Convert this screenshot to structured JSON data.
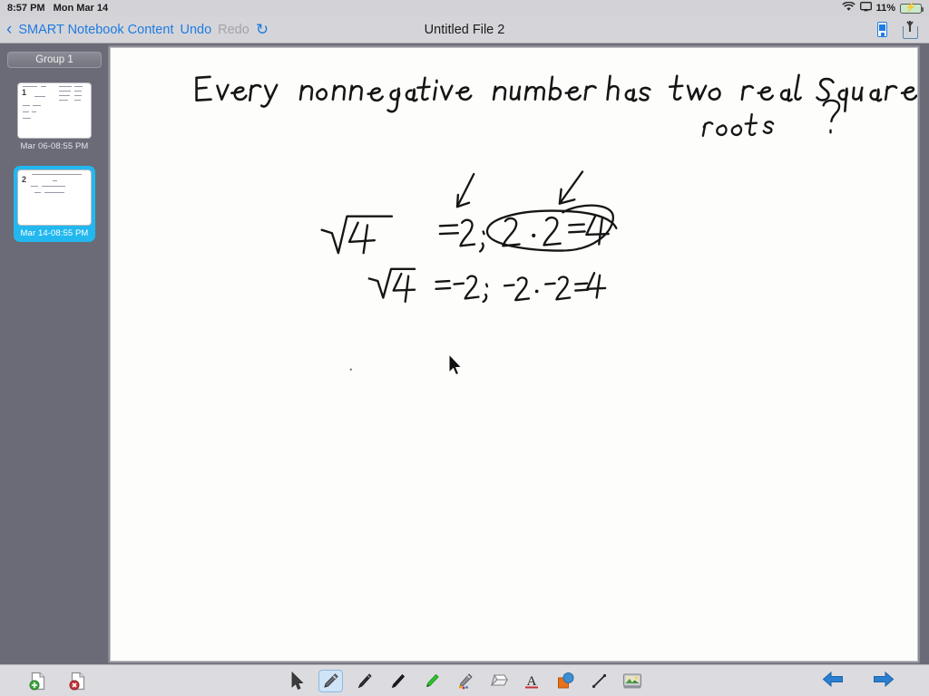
{
  "status_bar": {
    "time": "8:57 PM",
    "date": "Mon Mar 14",
    "battery_percent": "11%",
    "wifi_icon": "wifi-icon",
    "airplay_icon": "airplay-display-icon",
    "battery_icon": "battery-charging-icon"
  },
  "nav_bar": {
    "back_chevron": "‹",
    "back_label": "SMART Notebook Content",
    "undo_label": "Undo",
    "redo_label": "Redo",
    "refresh_icon": "↻",
    "title": "Untitled File 2",
    "device_icon": "device-icon",
    "share_icon": "share-icon"
  },
  "sidebar": {
    "group_label": "Group 1",
    "pages": [
      {
        "number": "1",
        "timestamp": "Mar 06-08:55 PM",
        "selected": false
      },
      {
        "number": "2",
        "timestamp": "Mar 14-08:55 PM",
        "selected": true
      }
    ],
    "selected_color": "#22b8ef"
  },
  "canvas": {
    "heading": "Every nonnegative number has two real square roots ?",
    "equation_1": "√4 = 2 ; 2 · 2 = 4",
    "equation_1_circled": "2 · 2 = 4",
    "equation_2": "√4 = -2 ; -2 · -2 = 4",
    "annotations": [
      "arrow pointing to = 2",
      "arrow pointing to circled 2 · 2 = 4"
    ],
    "ink_color": "#151515",
    "background_color": "#fdfdfb"
  },
  "toolbar": {
    "add_page_label": "add-page",
    "delete_page_label": "delete-page",
    "tools": [
      {
        "name": "select-pointer-tool",
        "active": false
      },
      {
        "name": "pen-tool",
        "active": true
      },
      {
        "name": "calligraphy-pen-tool",
        "active": false
      },
      {
        "name": "thin-pen-tool",
        "active": false
      },
      {
        "name": "highlighter-tool",
        "active": false
      },
      {
        "name": "creative-pen-tool",
        "active": false
      },
      {
        "name": "eraser-tool",
        "active": false
      },
      {
        "name": "text-tool",
        "active": false
      },
      {
        "name": "shapes-tool",
        "active": false
      },
      {
        "name": "line-tool",
        "active": false
      },
      {
        "name": "gallery-tool",
        "active": false
      }
    ],
    "prev_page_arrow": "←",
    "next_page_arrow": "→"
  }
}
